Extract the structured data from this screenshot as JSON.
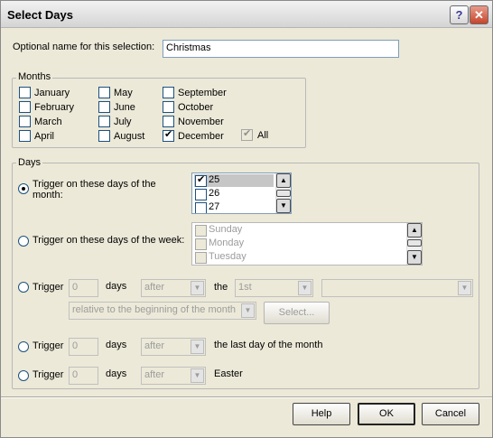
{
  "window": {
    "title": "Select Days"
  },
  "name_row": {
    "label": "Optional name for this selection:",
    "value": "Christmas"
  },
  "months": {
    "legend": "Months",
    "items": [
      {
        "label": "January",
        "checked": false
      },
      {
        "label": "February",
        "checked": false
      },
      {
        "label": "March",
        "checked": false
      },
      {
        "label": "April",
        "checked": false
      },
      {
        "label": "May",
        "checked": false
      },
      {
        "label": "June",
        "checked": false
      },
      {
        "label": "July",
        "checked": false
      },
      {
        "label": "August",
        "checked": false
      },
      {
        "label": "September",
        "checked": false
      },
      {
        "label": "October",
        "checked": false
      },
      {
        "label": "November",
        "checked": false
      },
      {
        "label": "December",
        "checked": true
      }
    ],
    "all_label": "All",
    "all_checked": true
  },
  "days": {
    "legend": "Days",
    "month_option": {
      "label_line1": "Trigger on these days of the",
      "label_line2": "month:",
      "selected": true
    },
    "month_list": [
      {
        "label": "25",
        "checked": true
      },
      {
        "label": "26",
        "checked": false
      },
      {
        "label": "27",
        "checked": false
      }
    ],
    "week_option": {
      "label": "Trigger on these days of the week:",
      "selected": false
    },
    "week_list": [
      {
        "label": "Sunday",
        "checked": false
      },
      {
        "label": "Monday",
        "checked": false
      },
      {
        "label": "Tuesday",
        "checked": false
      }
    ],
    "option3": {
      "trigger": "Trigger",
      "days_value": "0",
      "days": "days",
      "direction": "after",
      "the": "the",
      "ordinal": "1st",
      "weekday": "",
      "relative": "relative to the beginning of the month",
      "select_button": "Select..."
    },
    "option4": {
      "trigger": "Trigger",
      "days_value": "0",
      "days": "days",
      "direction": "after",
      "suffix": "the last day of the month"
    },
    "option5": {
      "trigger": "Trigger",
      "days_value": "0",
      "days": "days",
      "direction": "after",
      "suffix": "Easter"
    }
  },
  "buttons": {
    "help": "Help",
    "ok": "OK",
    "cancel": "Cancel"
  }
}
